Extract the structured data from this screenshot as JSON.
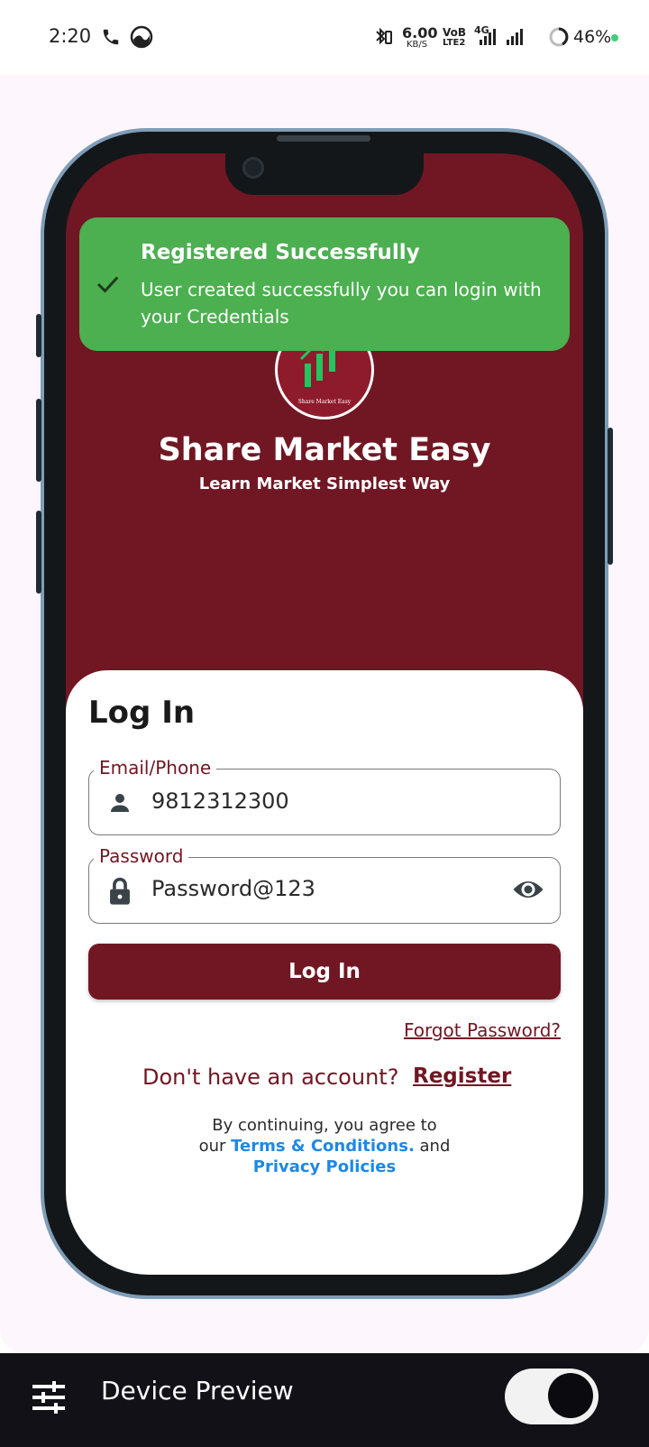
{
  "status_bar": {
    "time": "2:20",
    "net_speed": "6.00",
    "net_unit": "KB/S",
    "volte_top": "VoB",
    "volte_bottom": "LTE2",
    "network_type": "4G",
    "battery": "46%",
    "icons": [
      "phone-icon",
      "app-icon",
      "bluetooth-icon",
      "signal-icon",
      "battery-ring-icon"
    ]
  },
  "toast": {
    "title": "Registered Successfully",
    "message": "User created successfully you can login with your Credentials",
    "icon": "check-icon",
    "color": "#4caf50"
  },
  "app": {
    "name": "Share Market Easy",
    "tagline": "Learn Market Simplest Way",
    "logo_caption": "Share Market Easy",
    "brand_color": "#701723"
  },
  "login": {
    "heading": "Log In",
    "email_label": "Email/Phone",
    "email_value": "9812312300",
    "password_label": "Password",
    "password_value": "Password@123",
    "button_label": "Log In",
    "forgot_label": "Forgot Password?",
    "no_account_text": "Don't have an account?",
    "register_label": "Register",
    "terms_prefix": "By continuing, you agree to",
    "terms_our": "our",
    "terms_link": "Terms & Conditions.",
    "terms_and": "and",
    "privacy_link": "Privacy Policies",
    "link_color": "#1e88e5"
  },
  "toolbar": {
    "title": "Device Preview",
    "settings_icon": "sliders-icon",
    "toggle_on": true
  }
}
